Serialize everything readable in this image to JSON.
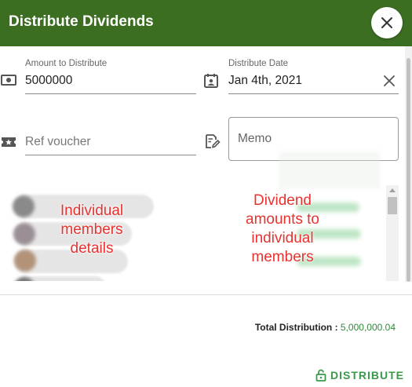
{
  "dialog": {
    "title": "Distribute Dividends",
    "close_icon": "close-icon"
  },
  "form": {
    "amount_label": "Amount to Distribute",
    "amount_value": "5000000",
    "amount_icon": "money-icon",
    "date_label": "Distribute Date",
    "date_value": "Jan 4th, 2021",
    "date_icon": "contact-calendar-icon",
    "clear_icon": "clear-icon",
    "ref_placeholder": "Ref voucher",
    "ref_icon": "voucher-star-icon",
    "memo_placeholder": "Memo",
    "memo_icon": "edit-note-icon"
  },
  "annotations": {
    "members": "Individual members details",
    "amounts": "Dividend amounts to individual members"
  },
  "footer": {
    "total_label": "Total Distribution :",
    "total_value": "5,000,000.04",
    "distribute_label": "DISTRIBUTE",
    "distribute_icon": "lock-open-icon"
  },
  "colors": {
    "header": "#3c6e22",
    "accent_green": "#3a9a4a",
    "annotation_red": "#e8322f"
  }
}
